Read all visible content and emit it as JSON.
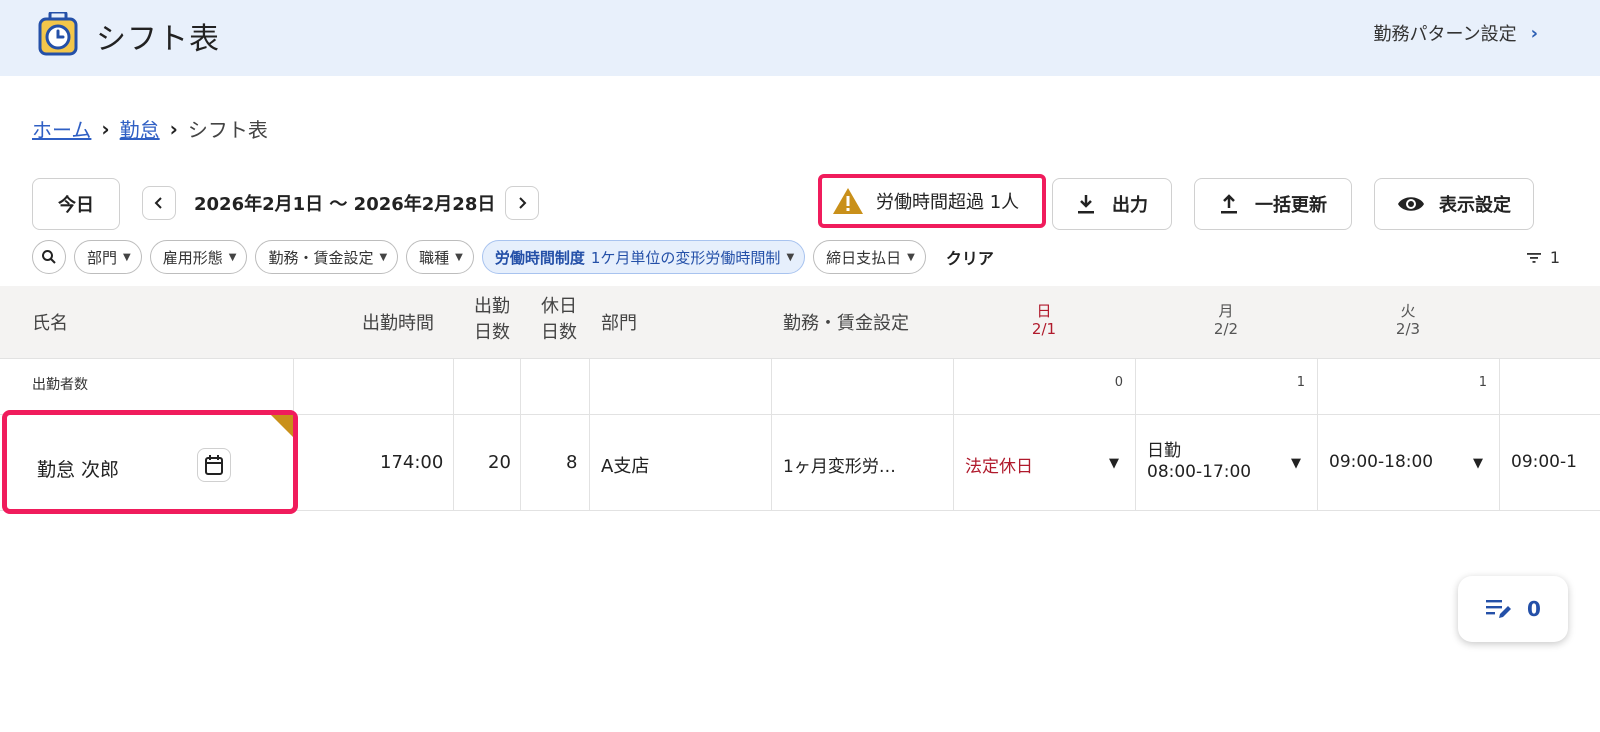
{
  "header": {
    "title": "シフト表",
    "pattern_link": "勤務パターン設定"
  },
  "breadcrumb": {
    "items": [
      {
        "label": "ホーム"
      },
      {
        "label": "勤怠"
      },
      {
        "label": "シフト表"
      }
    ]
  },
  "toolbar": {
    "today_label": "今日",
    "date_range": "2026年2月1日 〜 2026年2月28日",
    "overtime_label": "労働時間超過 1人",
    "export_label": "出力",
    "bulk_update_label": "一括更新",
    "display_settings_label": "表示設定"
  },
  "filters": {
    "chips": [
      {
        "label": "部門"
      },
      {
        "label": "雇用形態"
      },
      {
        "label": "勤務・賃金設定"
      },
      {
        "label": "職種"
      },
      {
        "label": "労働時間制度",
        "value": "1ケ月単位の変形労働時間制"
      },
      {
        "label": "締日支払日"
      }
    ],
    "clear_label": "クリア",
    "count": "1"
  },
  "table": {
    "columns": {
      "name": "氏名",
      "work_time": "出勤時間",
      "work_days": "出勤",
      "work_days_2": "日数",
      "off_days": "休日",
      "off_days_2": "日数",
      "department": "部門",
      "wage_setting": "勤務・賃金設定"
    },
    "days": [
      {
        "weekday": "日",
        "date": "2/1"
      },
      {
        "weekday": "月",
        "date": "2/2"
      },
      {
        "weekday": "火",
        "date": "2/3"
      }
    ],
    "summary_row": {
      "label": "出勤者数",
      "counts": [
        "0",
        "1",
        "1"
      ]
    },
    "employees": [
      {
        "name": "勤怠 次郎",
        "work_time": "174:00",
        "work_days": "20",
        "off_days": "8",
        "department": "A支店",
        "wage_setting": "1ヶ月変形労…",
        "shifts": [
          {
            "line1": "法定休日",
            "line2": ""
          },
          {
            "line1": "日勤",
            "line2": "08:00-17:00"
          },
          {
            "line1": "09:00-18:00",
            "line2": ""
          },
          {
            "line1": "09:00-1",
            "line2": ""
          }
        ]
      }
    ]
  },
  "fab": {
    "count": "0"
  },
  "colors": {
    "header_bg": "#e8f0fb",
    "highlight": "#f01c5c",
    "link": "#2f5fc4",
    "sunday": "#b01a2c",
    "warning": "#c9901a"
  }
}
